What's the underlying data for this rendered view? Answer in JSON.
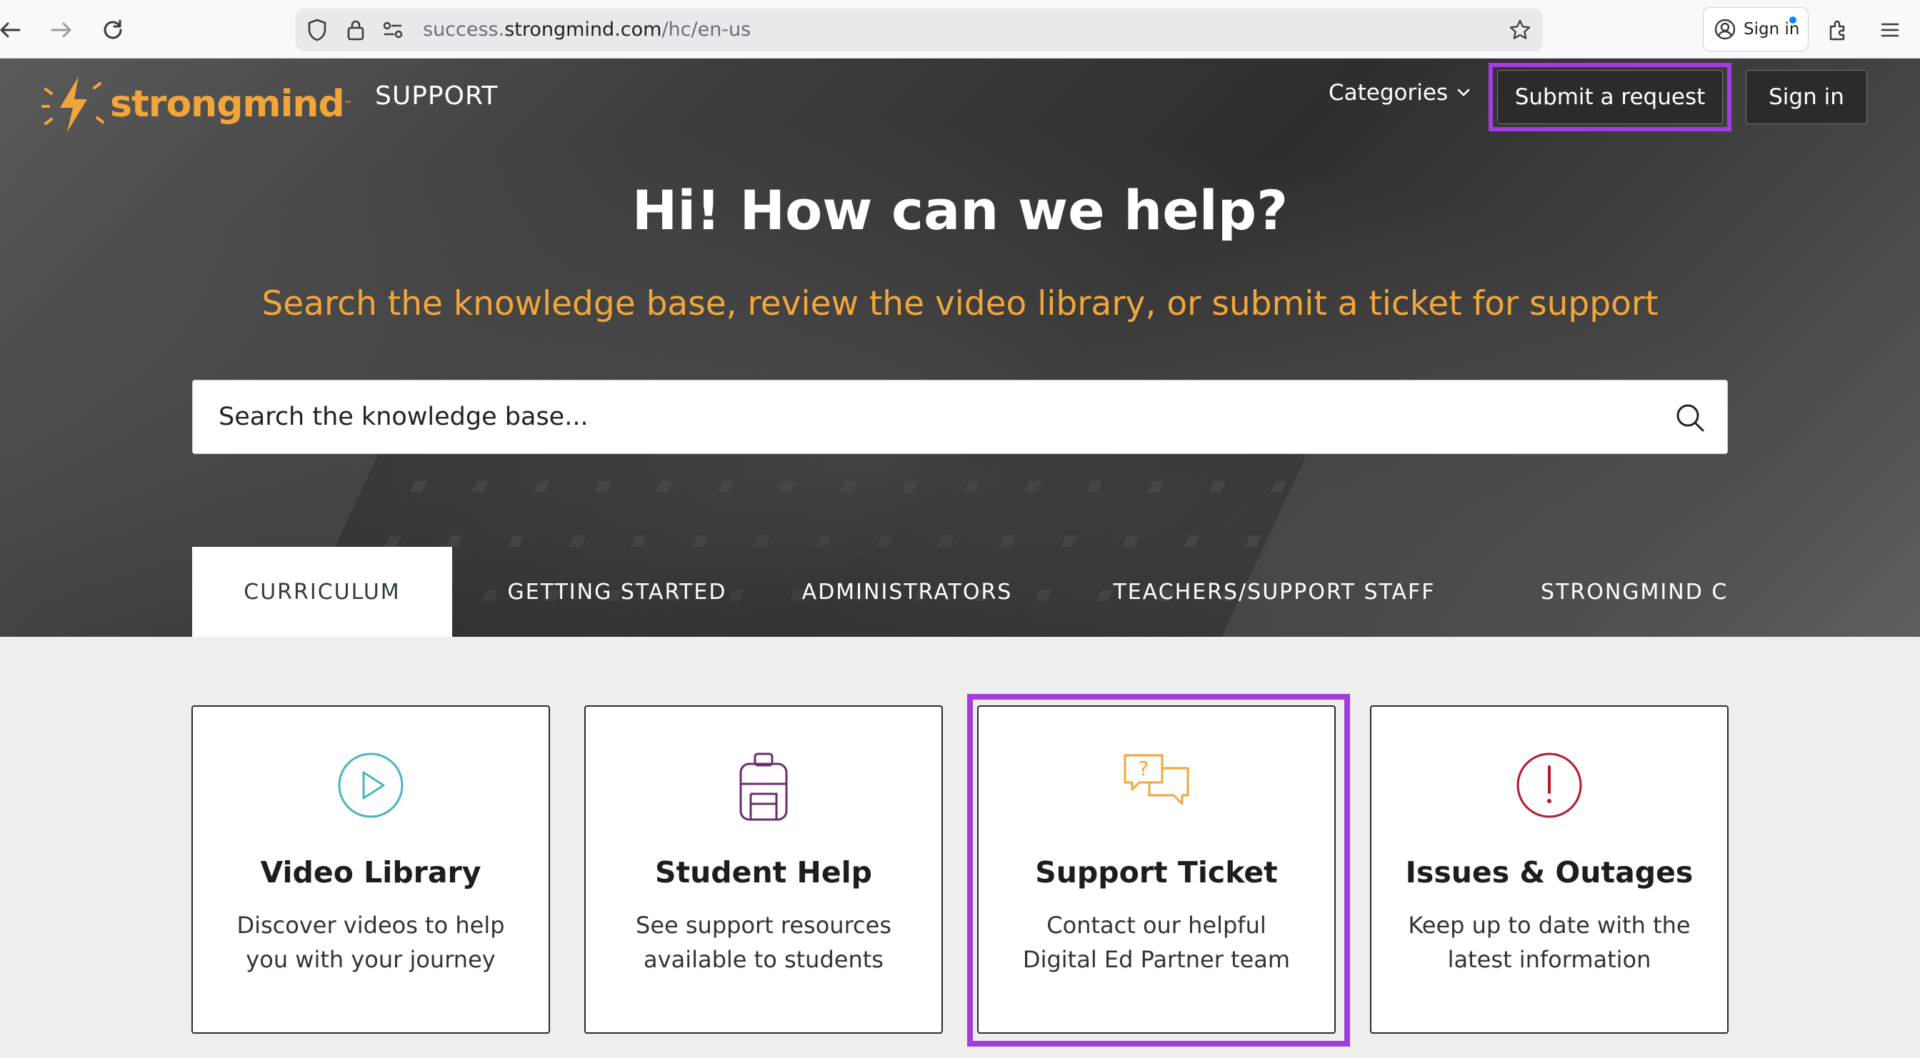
{
  "browser": {
    "url_prefix": "success.",
    "url_host": "strongmind.com",
    "url_path": "/hc/en-us",
    "profile_label": "Sign in"
  },
  "header": {
    "logo_text": "strongmind",
    "logo_tm": "™",
    "section_label": "SUPPORT",
    "categories_label": "Categories",
    "submit_label": "Submit a request",
    "signin_label": "Sign in"
  },
  "hero": {
    "title": "Hi! How can we help?",
    "subtitle": "Search the knowledge base, review the video library, or submit a ticket for support",
    "search_placeholder": "Search the knowledge base..."
  },
  "tabs": [
    {
      "label": "CURRICULUM",
      "active": true
    },
    {
      "label": "GETTING STARTED",
      "active": false
    },
    {
      "label": "ADMINISTRATORS",
      "active": false
    },
    {
      "label": "TEACHERS/SUPPORT STAFF",
      "active": false
    },
    {
      "label": "STRONGMIND CE",
      "active": false
    }
  ],
  "cards": [
    {
      "title": "Video Library",
      "line1": "Discover videos to help",
      "line2": "you with your journey",
      "icon": "play-circle-icon",
      "color": "#4ab3c4"
    },
    {
      "title": "Student Help",
      "line1": "See support resources",
      "line2": "available to students",
      "icon": "backpack-icon",
      "color": "#6a2c70"
    },
    {
      "title": "Support Ticket",
      "line1": "Contact our helpful",
      "line2": "Digital Ed Partner team",
      "icon": "chat-bubbles-icon",
      "color": "#f2a63a"
    },
    {
      "title": "Issues & Outages",
      "line1": "Keep up to date with the",
      "line2": "latest information",
      "icon": "alert-circle-icon",
      "color": "#b5172d"
    }
  ],
  "colors": {
    "brand_orange": "#f2a63a",
    "highlight_purple": "#a33de0"
  }
}
